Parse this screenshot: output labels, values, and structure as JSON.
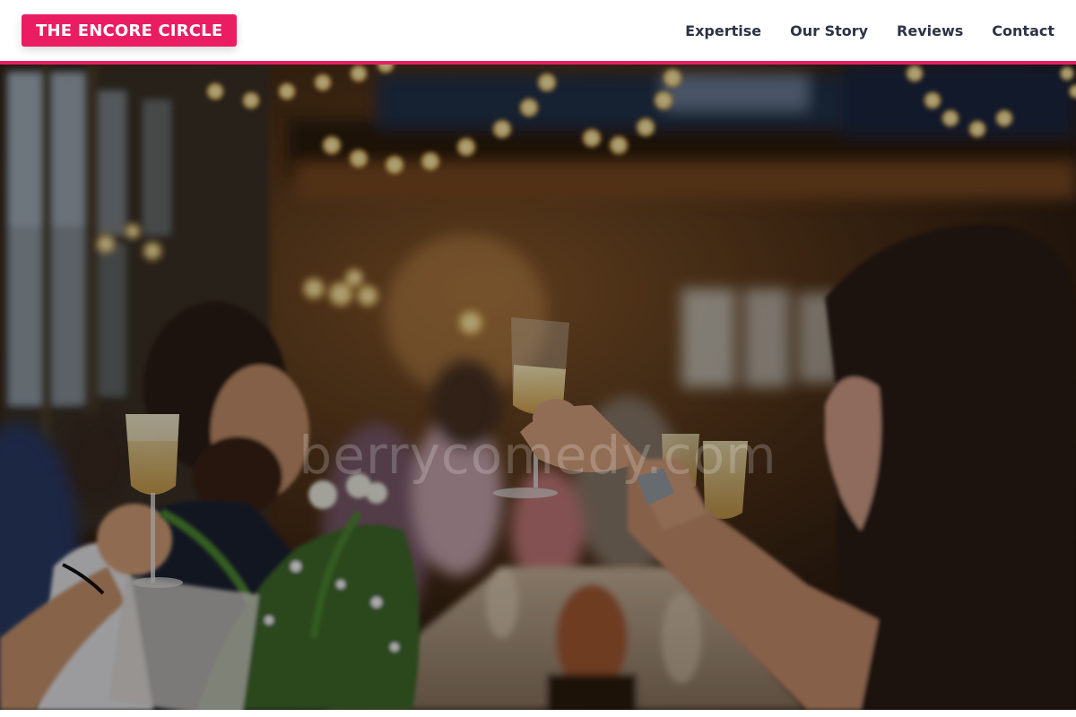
{
  "header": {
    "logo_text": "THE ENCORE CIRCLE",
    "nav": [
      {
        "label": "Expertise"
      },
      {
        "label": "Our Story"
      },
      {
        "label": "Reviews"
      },
      {
        "label": "Contact"
      }
    ]
  },
  "hero": {
    "watermark": "berrycomedy.com",
    "image_subject": "guests raising champagne glasses at a banquet",
    "overlay_opacity": 0.35
  },
  "colors": {
    "brand": "#ea1d63",
    "nav_text": "#2b3445",
    "header_bg": "#ffffff"
  }
}
